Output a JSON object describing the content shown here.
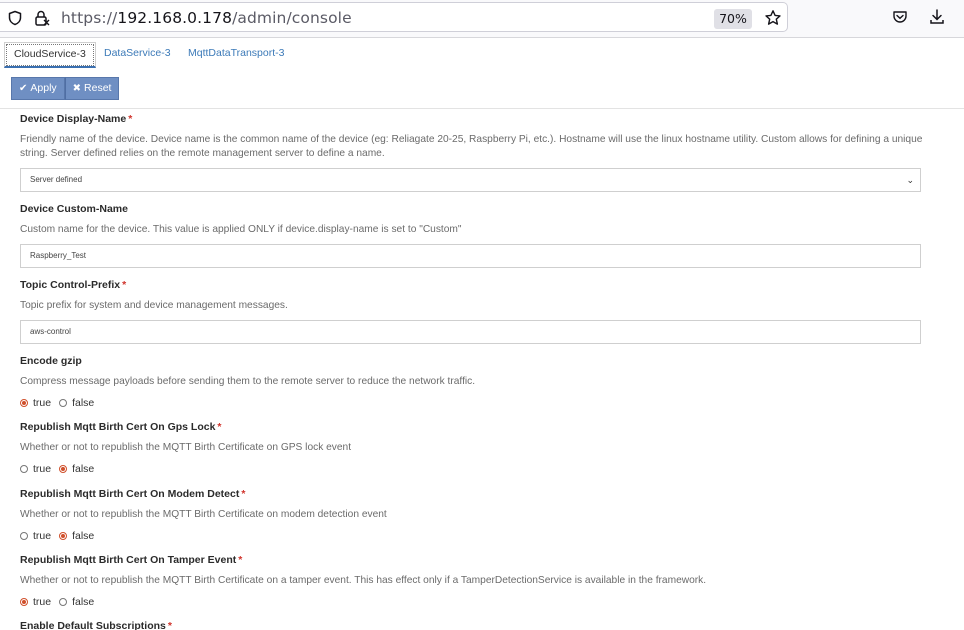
{
  "browser": {
    "url_scheme": "https://",
    "url_host": "192.168.0.178",
    "url_path": "/admin/console",
    "zoom": "70%"
  },
  "tabs": [
    {
      "label": "CloudService-3",
      "active": true
    },
    {
      "label": "DataService-3",
      "active": false
    },
    {
      "label": "MqttDataTransport-3",
      "active": false
    }
  ],
  "toolbar": {
    "apply_label": "Apply",
    "reset_label": "Reset"
  },
  "fields": {
    "display_name": {
      "label": "Device Display-Name",
      "description": "Friendly name of the device. Device name is the common name of the device (eg: Reliagate 20-25, Raspberry Pi, etc.). Hostname will use the linux hostname utility. Custom allows for defining a unique string. Server defined relies on the remote management server to define a name.",
      "value": "Server defined"
    },
    "custom_name": {
      "label": "Device Custom-Name",
      "description": "Custom name for the device. This value is applied ONLY if device.display-name is set to \"Custom\"",
      "value": "Raspberry_Test"
    },
    "control_prefix": {
      "label": "Topic Control-Prefix",
      "description": "Topic prefix for system and device management messages.",
      "value": "aws-control"
    },
    "encode_gzip": {
      "label": "Encode gzip",
      "description": "Compress message payloads before sending them to the remote server to reduce the network traffic.",
      "true_label": "true",
      "false_label": "false",
      "selected": "true"
    },
    "birth_gps": {
      "label": "Republish Mqtt Birth Cert On Gps Lock",
      "description": "Whether or not to republish the MQTT Birth Certificate on GPS lock event",
      "true_label": "true",
      "false_label": "false",
      "selected": "false"
    },
    "birth_modem": {
      "label": "Republish Mqtt Birth Cert On Modem Detect",
      "description": "Whether or not to republish the MQTT Birth Certificate on modem detection event",
      "true_label": "true",
      "false_label": "false",
      "selected": "false"
    },
    "birth_tamper": {
      "label": "Republish Mqtt Birth Cert On Tamper Event",
      "description": "Whether or not to republish the MQTT Birth Certificate on a tamper event. This has effect only if a TamperDetectionService is available in the framework.",
      "true_label": "true",
      "false_label": "false",
      "selected": "true"
    },
    "default_subscriptions": {
      "label": "Enable Default Subscriptions"
    }
  },
  "required_marker": "*",
  "colors": {
    "accent": "#6f8fc3",
    "link": "#3c7ab8",
    "required": "#d0342c",
    "radio_checked": "#d0502c"
  },
  "icons": [
    "shield-icon",
    "lock-icon",
    "star-icon",
    "pocket-icon",
    "download-icon",
    "check-icon",
    "x-icon",
    "chevron-down-icon"
  ]
}
